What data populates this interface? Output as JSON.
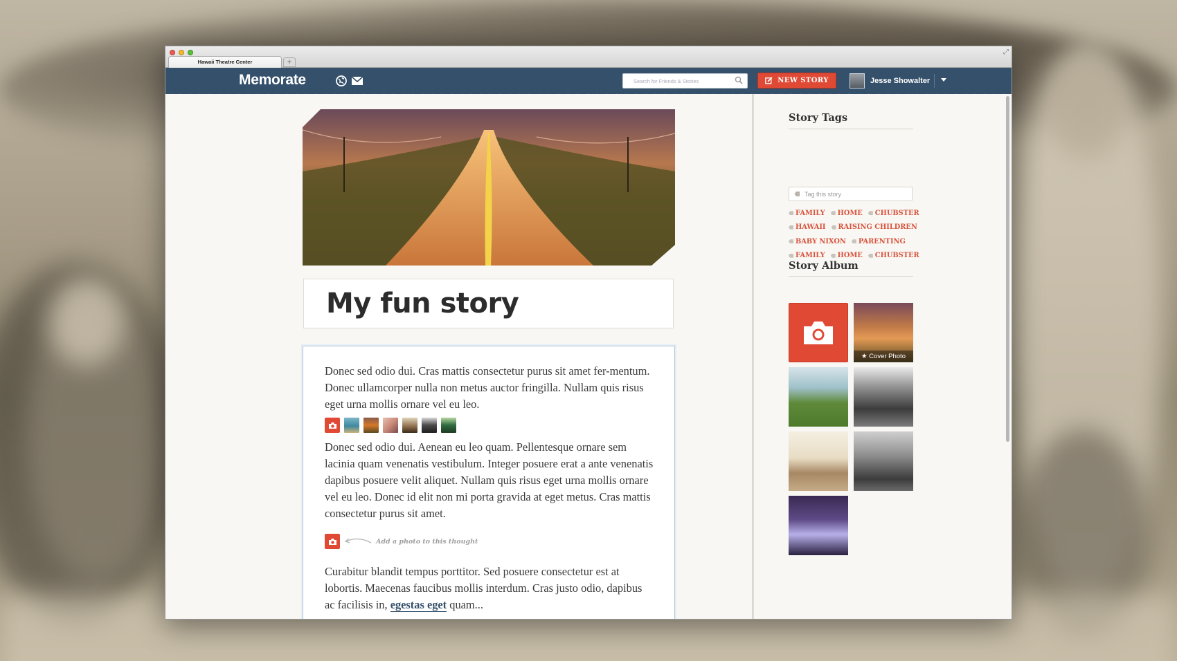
{
  "browser": {
    "tab_title": "Hawaii Theatre Center",
    "new_tab_label": "+"
  },
  "header": {
    "logo": "Memorate",
    "search_placeholder": "Search for Friends & Stories",
    "new_story_label": "NEW STORY",
    "user_name": "Jesse Showalter"
  },
  "story": {
    "title": "My fun story",
    "paragraphs": [
      "Donec sed odio dui. Cras mattis consectetur purus sit amet fer-mentum. Donec ullamcorper nulla non metus auctor fringilla. Nullam quis risus eget urna mollis ornare vel eu leo.",
      "Donec sed odio dui. Aenean eu leo quam. Pellentesque ornare sem lacinia quam venenatis vestibulum. Integer posuere erat a ante venenatis dapibus posuere velit aliquet. Nullam quis risus eget urna mollis ornare vel eu leo. Donec id elit non mi porta gravida at eget metus. Cras mattis consectetur purus sit amet.",
      "Curabitur blandit tempus porttitor. Sed posuere consectetur est at lobortis. Maecenas faucibus mollis interdum. Cras justo odio, dapibus ac facilisis in,"
    ],
    "paragraph3_link": "egestas eget",
    "paragraph3_tail": " quam...",
    "add_photo_hint": "Add a photo to this thought",
    "thumbnail_colors": [
      "#3f8aa0",
      "#d4782a",
      "#c98a7a",
      "#8b6b4a",
      "#4a4a4a",
      "#2f6b3f"
    ]
  },
  "sidebar": {
    "tags_heading": "Story Tags",
    "tag_placeholder": "Tag this story",
    "tag_rows": [
      [
        "FAMILY",
        "HOME",
        "CHUBSTER"
      ],
      [
        "HAWAII",
        "RAISING CHILDREN"
      ],
      [
        "BABY NIXON",
        "PARENTING"
      ],
      [
        "FAMILY",
        "HOME",
        "CHUBSTER"
      ]
    ],
    "album_heading": "Story Album",
    "cover_photo_label": "★ Cover Photo"
  },
  "colors": {
    "brand_navy": "#35506b",
    "accent_red": "#e04a35",
    "tag_red": "#d9533d"
  }
}
